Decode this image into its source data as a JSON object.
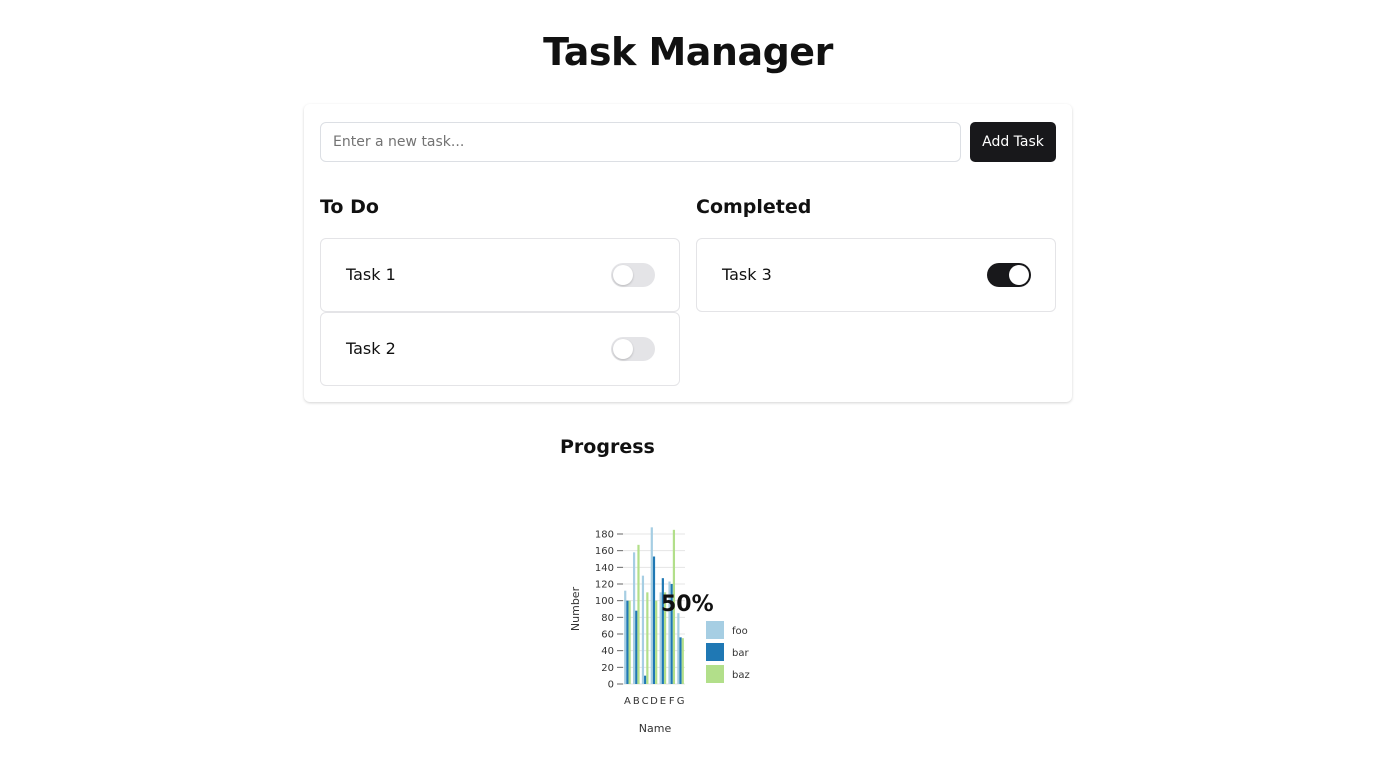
{
  "header": {
    "title": "Task Manager"
  },
  "new_task": {
    "placeholder": "Enter a new task...",
    "value": "",
    "add_label": "Add Task"
  },
  "todo": {
    "title": "To Do",
    "tasks": [
      {
        "label": "Task 1",
        "completed": false
      },
      {
        "label": "Task 2",
        "completed": false
      }
    ]
  },
  "completed": {
    "title": "Completed",
    "tasks": [
      {
        "label": "Task 3",
        "completed": true
      }
    ]
  },
  "progress": {
    "title": "Progress",
    "percent_label": "50%"
  },
  "colors": {
    "foo": "#a6cee3",
    "bar": "#1f78b4",
    "baz": "#b2df8a",
    "toggle_on": "#18181b",
    "toggle_off": "#e4e4e7"
  },
  "chart_data": {
    "type": "bar",
    "categories": [
      "A",
      "B",
      "C",
      "D",
      "E",
      "F",
      "G"
    ],
    "series": [
      {
        "name": "foo",
        "values": [
          112,
          158,
          130,
          188,
          110,
          123,
          85
        ]
      },
      {
        "name": "bar",
        "values": [
          100,
          88,
          10,
          153,
          127,
          120,
          56
        ]
      },
      {
        "name": "baz",
        "values": [
          100,
          167,
          110,
          100,
          110,
          185,
          55
        ]
      }
    ],
    "xlabel": "Name",
    "ylabel": "Number",
    "ylim": [
      0,
      180
    ],
    "yticks": [
      0,
      20,
      40,
      60,
      80,
      100,
      120,
      140,
      160,
      180
    ],
    "legend_position": "right",
    "grid": true
  }
}
